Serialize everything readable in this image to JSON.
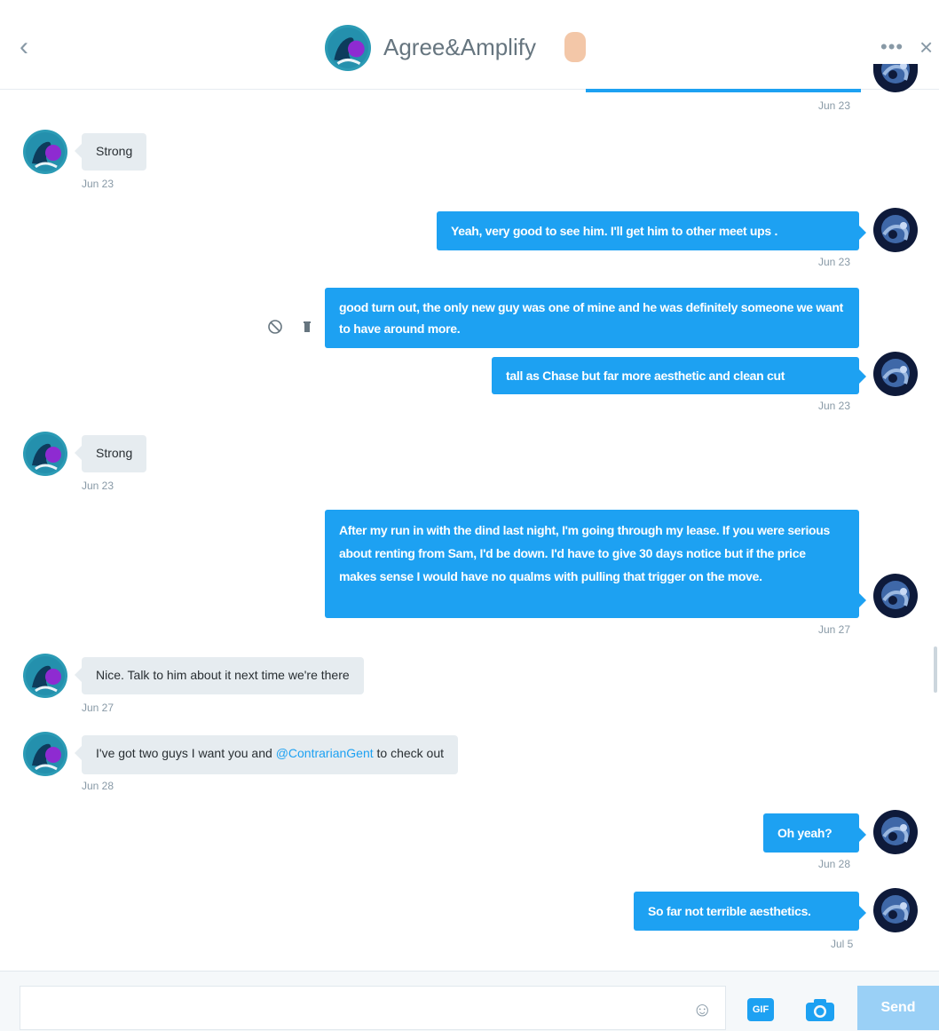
{
  "header": {
    "back_glyph": "‹",
    "title": "Agree&Amplify",
    "more_glyph": "•••",
    "close_glyph": "×"
  },
  "messages": [
    {
      "text": "Strong",
      "time": "Jun 23"
    },
    {
      "text": "Yeah, very good to see him. I'll get him to other meet ups .",
      "time": "Jun 23"
    },
    {
      "text": "good turn out, the only new guy was one of mine and he was definitely someone we want to have around more."
    },
    {
      "text": "tall as Chase but far more aesthetic and clean cut",
      "time": "Jun 23"
    },
    {
      "text": "Strong",
      "time": "Jun 23"
    },
    {
      "text": "After my run in with the dind last night, I'm going through my lease. If you were serious about renting from Sam, I'd be down. I'd have to give 30 days notice but if the price makes sense I would have no qualms with pulling that trigger on the move.",
      "time": "Jun 27"
    },
    {
      "text": "Nice. Talk to him about it next time we're there",
      "time": "Jun 27"
    },
    {
      "before": "I've got two guys I want you and ",
      "mention": "@ContrarianGent",
      "after": " to check out",
      "time": "Jun 28"
    },
    {
      "text": "Oh yeah?",
      "time": "Jun 28"
    },
    {
      "text": "So far not terrible aesthetics.",
      "time": "Jul 5"
    }
  ],
  "top_partial_time": "Jun 23",
  "composer": {
    "placeholder": "",
    "gif_label": "GIF",
    "send_label": "Send"
  },
  "colors": {
    "accent": "#1da1f2",
    "incoming_bubble": "#e6ecf0",
    "timestamp": "#8899a6"
  },
  "icons": [
    "back-chevron-icon",
    "more-dots-icon",
    "close-icon",
    "block-icon",
    "trash-icon",
    "emoji-icon",
    "gif-icon",
    "camera-icon"
  ]
}
